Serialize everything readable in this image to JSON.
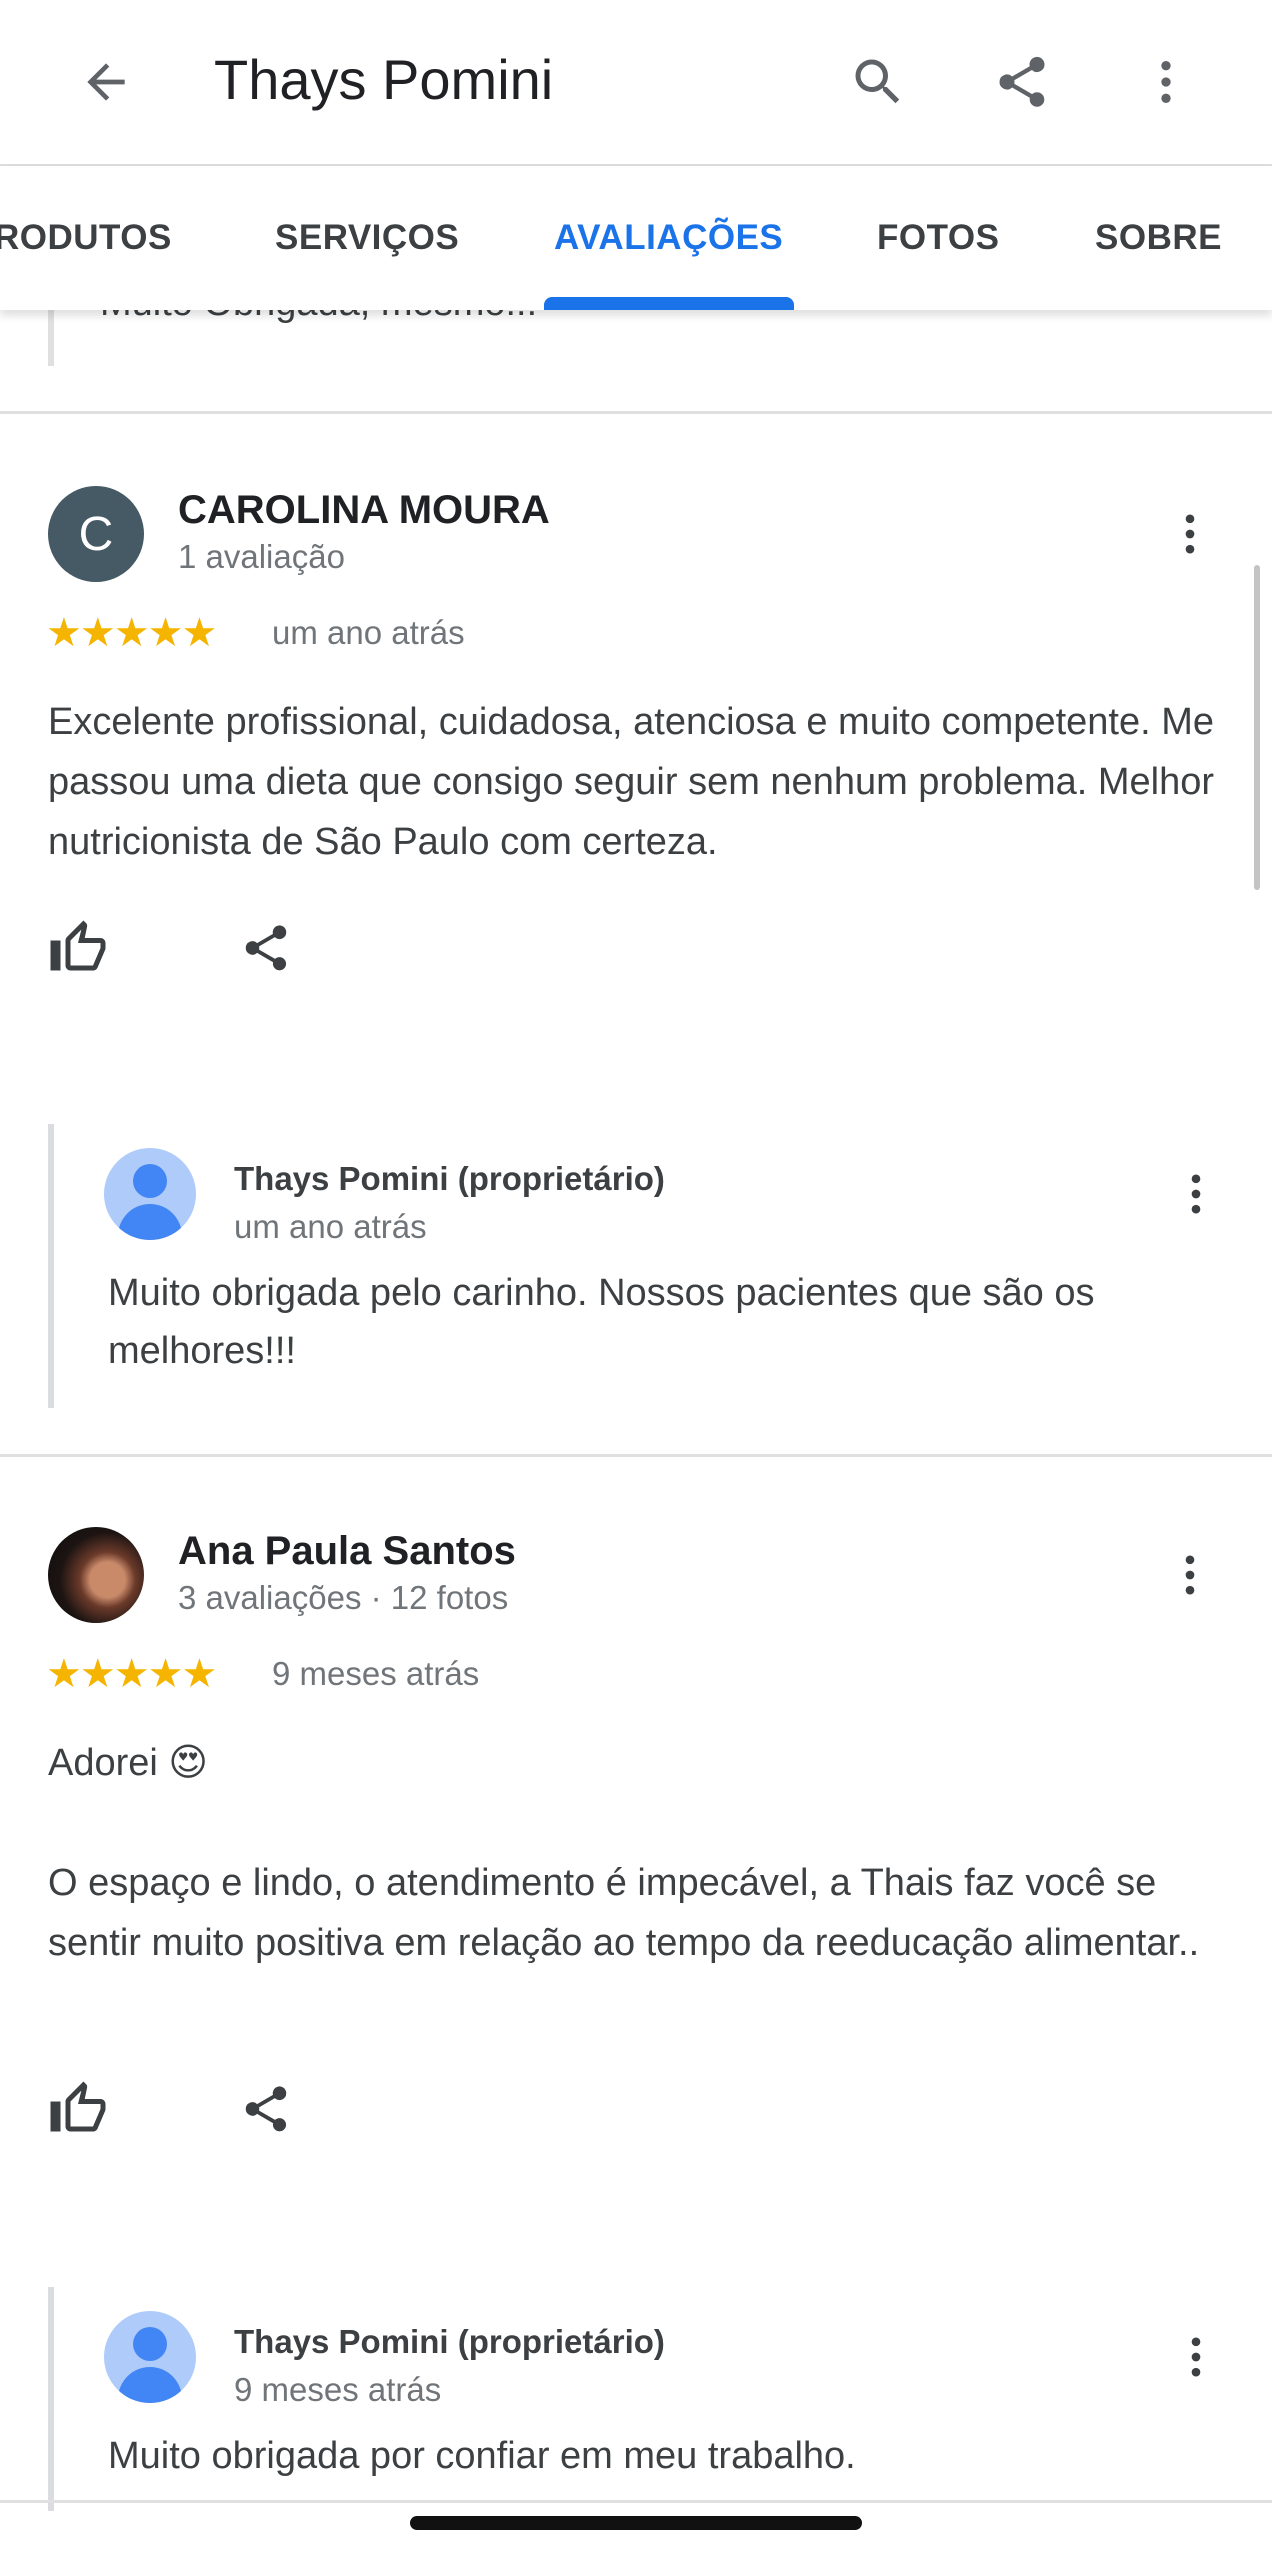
{
  "appbar": {
    "title": "Thays Pomini",
    "icons": [
      "back-arrow-icon",
      "search-icon",
      "share-icon",
      "more-vert-icon"
    ]
  },
  "tabs": [
    {
      "label": "RODUTOS",
      "active": false
    },
    {
      "label": "SERVIÇOS",
      "active": false
    },
    {
      "label": "AVALIAÇÕES",
      "active": true
    },
    {
      "label": "FOTOS",
      "active": false
    },
    {
      "label": "SOBRE",
      "active": false
    }
  ],
  "partial_reply_text": "Muito Obrigada, mesmo!!!",
  "reviews": [
    {
      "avatar_letter": "C",
      "name": "CAROLINA MOURA",
      "meta": "1 avaliação",
      "stars": "★★★★★",
      "rating": 5,
      "time": "um ano atrás",
      "text": "Excelente profissional, cuidadosa, atenciosa e muito competente. Me passou uma dieta que consigo seguir sem nenhum problema. Melhor nutricionista de São Paulo com certeza.",
      "reply": {
        "owner": "Thays Pomini (proprietário)",
        "time": "um ano atrás",
        "text": "Muito obrigada pelo carinho. Nossos pacientes que são os melhores!!!"
      }
    },
    {
      "name": "Ana Paula Santos",
      "meta": "3 avaliações · 12 fotos",
      "stars": "★★★★★",
      "rating": 5,
      "time": "9 meses atrás",
      "text_line1": "Adorei 😍",
      "text": "O espaço e lindo, o atendimento é impecável, a Thais faz você se sentir muito positiva em relação ao tempo da reeducação alimentar..",
      "reply": {
        "owner": "Thays Pomini (proprietário)",
        "time": "9 meses atrás",
        "text": "Muito obrigada por confiar em meu trabalho."
      }
    }
  ],
  "colors": {
    "accent": "#1a73e8",
    "star": "#f4b400",
    "text_primary": "#202124",
    "text_secondary": "#70757a",
    "avatar_letter_bg": "#455a64",
    "owner_avatar_bg": "#aecbfa"
  }
}
